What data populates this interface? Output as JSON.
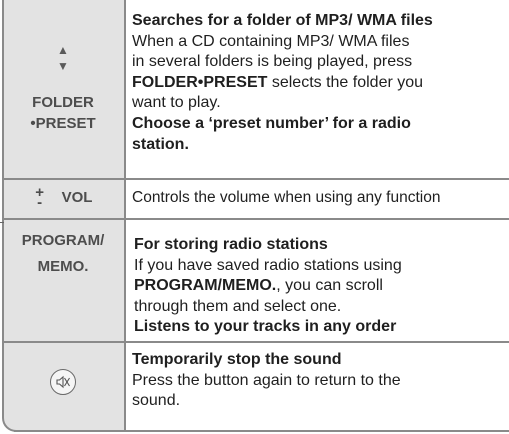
{
  "rows": [
    {
      "key": {
        "arrow_up": "▲",
        "arrow_down": "▼",
        "line1": "FOLDER",
        "line2": "•PRESET"
      },
      "desc": {
        "title": "Searches for a folder of MP3/ WMA files",
        "l1": "When a CD containing MP3/ WMA files",
        "l2": "in several folders is being played, press",
        "l3_bold": "FOLDER•PRESET",
        "l3_rest": " selects the folder you",
        "l4": "want to play.",
        "l5": "Choose a ‘preset number’ for a radio",
        "l6": "station."
      }
    },
    {
      "key": {
        "plus": "+",
        "minus": "-",
        "label": "VOL"
      },
      "desc": {
        "text": "Controls the volume when using any function"
      }
    },
    {
      "key": {
        "line1": "PROGRAM/",
        "line2": "MEMO."
      },
      "desc": {
        "title": "For storing radio stations",
        "l1": "If you have saved radio stations using",
        "l2_bold": "PROGRAM/MEMO.",
        "l2_rest": ", you can scroll",
        "l3": "through them and select one.",
        "l4": "Listens to your tracks in any order"
      }
    },
    {
      "key": {
        "icon": "mute-icon"
      },
      "desc": {
        "title": "Temporarily stop the sound",
        "l1": "Press the button again to return to the",
        "l2": "sound."
      }
    }
  ],
  "colors": {
    "key_bg": "#e3e3e3",
    "border": "#8a8a8a",
    "key_text": "#4d4d4d"
  }
}
